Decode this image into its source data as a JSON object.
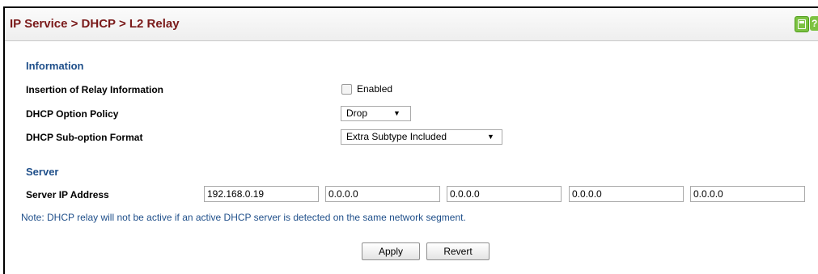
{
  "header": {
    "title": "IP Service > DHCP > L2 Relay",
    "save_icon": "save-icon",
    "help_icon": "help-icon",
    "help_glyph": "?"
  },
  "information": {
    "heading": "Information",
    "insertion_label": "Insertion of Relay Information",
    "insertion_checkbox_label": "Enabled",
    "insertion_checked": false,
    "option_policy_label": "DHCP Option Policy",
    "option_policy_value": "Drop",
    "suboption_format_label": "DHCP Sub-option Format",
    "suboption_format_value": "Extra Subtype Included"
  },
  "server": {
    "heading": "Server",
    "ip_label": "Server IP Address",
    "ips": [
      "192.168.0.19",
      "0.0.0.0",
      "0.0.0.0",
      "0.0.0.0",
      "0.0.0.0"
    ]
  },
  "note": "Note: DHCP relay will not be active if an active DHCP server is detected on the same network segment.",
  "buttons": {
    "apply": "Apply",
    "revert": "Revert"
  },
  "colors": {
    "title": "#7a1a1a",
    "section": "#1f4f8a",
    "note": "#1f4f8a",
    "icon": "#7cc242"
  }
}
